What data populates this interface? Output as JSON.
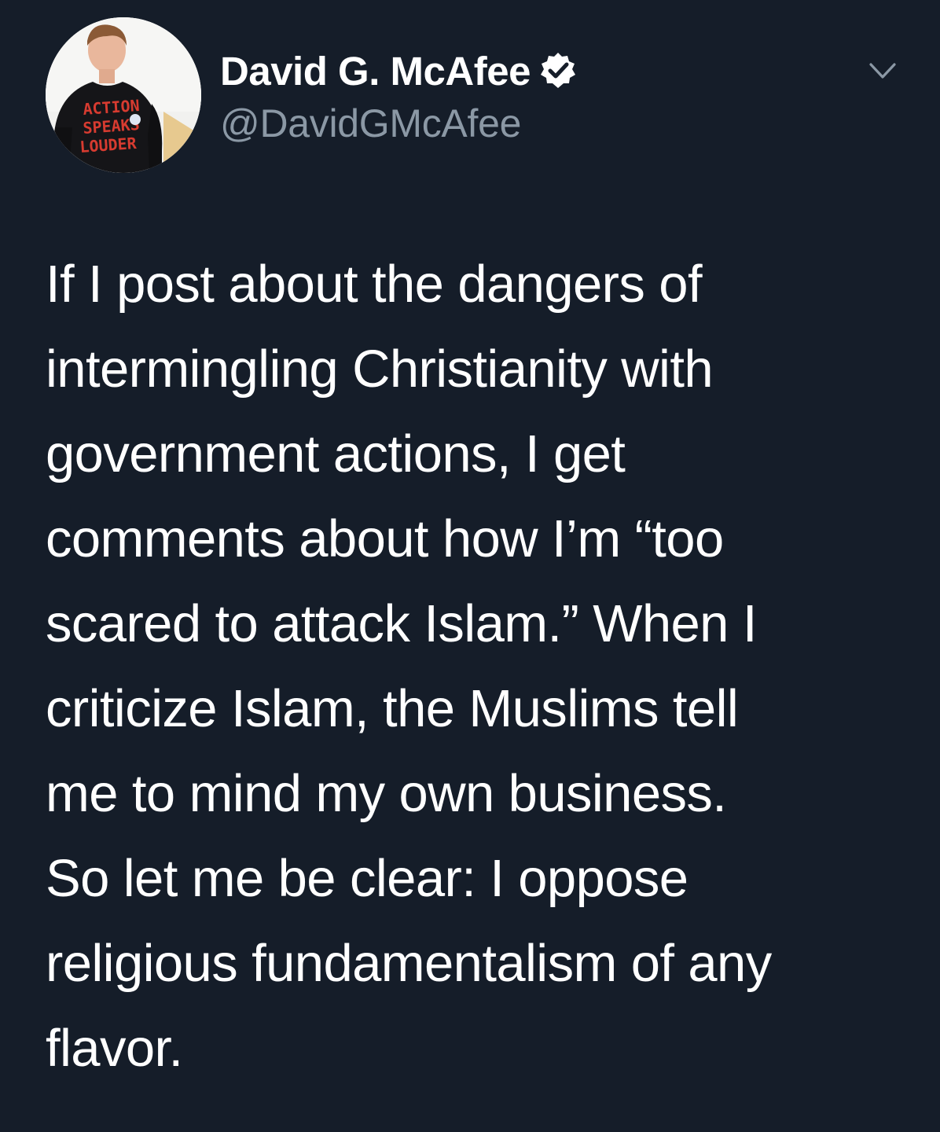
{
  "tweet": {
    "author": {
      "display_name": "David G. McAfee",
      "handle": "@DavidGMcAfee",
      "verified": true,
      "avatar_icon": "profile-photo",
      "avatar_shirt_text": [
        "ACTION",
        "SPEAKS",
        "LOUDER"
      ]
    },
    "menu_icon": "chevron-down-icon",
    "body": {
      "paragraph_1": [
        "If I post about the dangers of",
        "intermingling Christianity with",
        "government actions, I get",
        "comments about how I’m “too",
        "scared to attack Islam.” When I",
        "criticize Islam, the Muslims tell",
        "me to mind my own business."
      ],
      "paragraph_2": [
        "So let me be clear: I oppose",
        "religious fundamentalism of any",
        "flavor."
      ]
    }
  },
  "colors": {
    "background": "#151d29",
    "text_primary": "#ffffff",
    "text_secondary": "#8b98a5",
    "verified_badge": "#ffffff"
  }
}
